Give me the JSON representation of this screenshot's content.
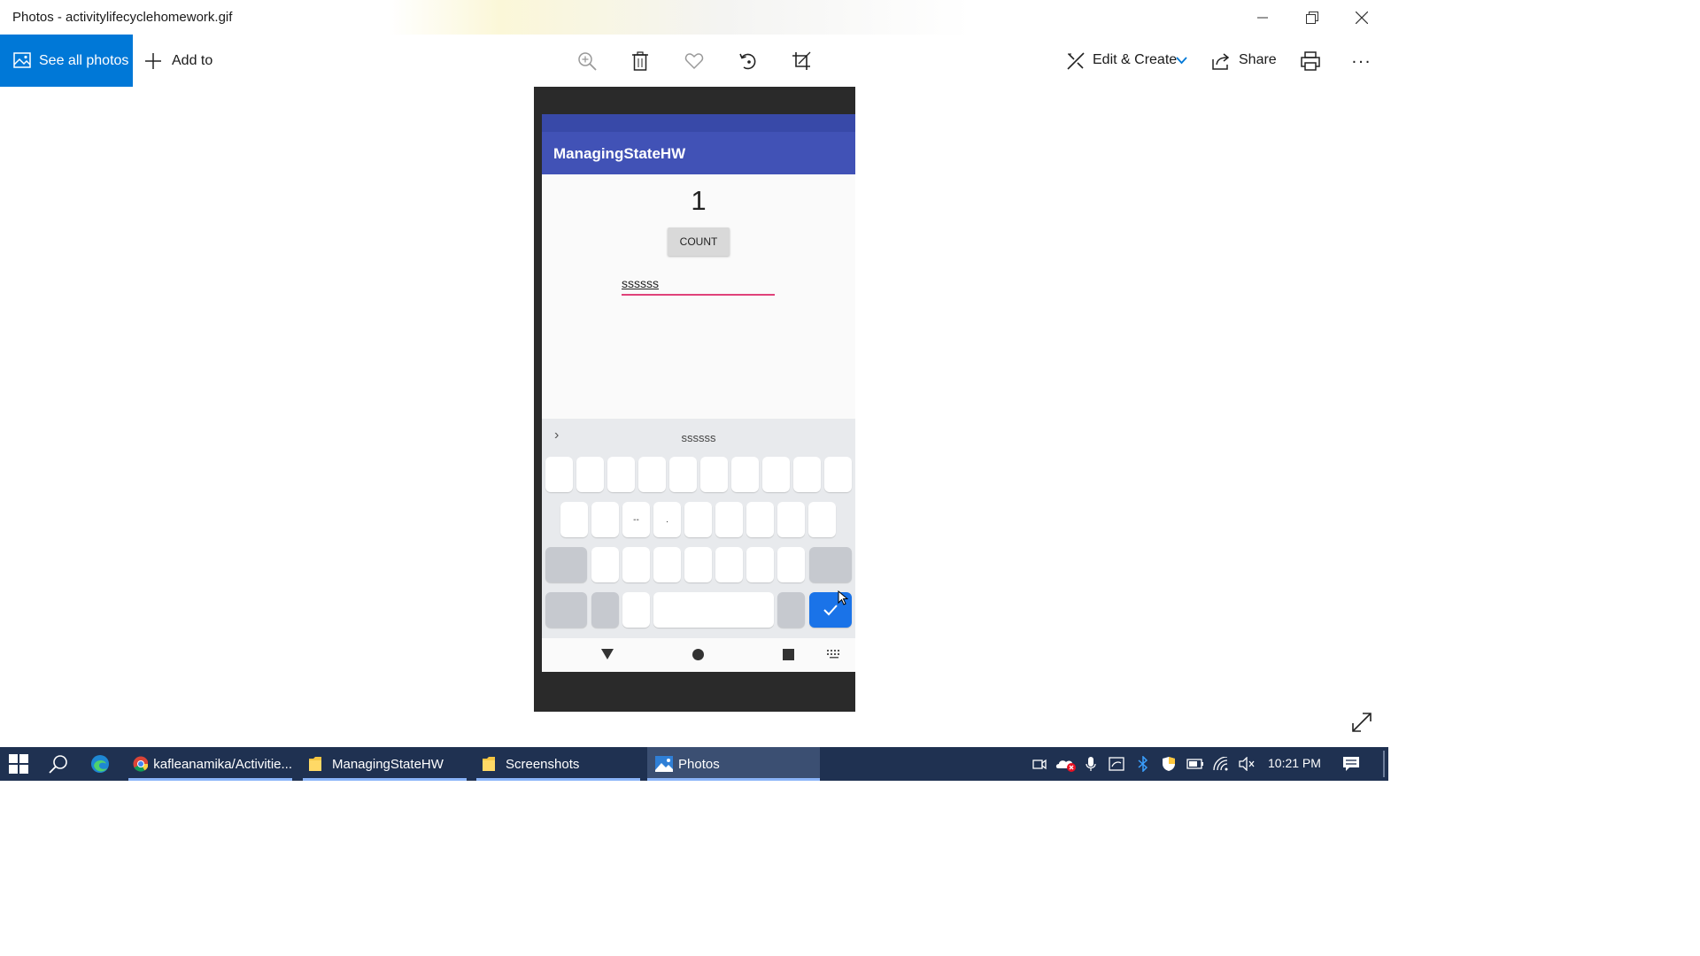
{
  "window": {
    "title": "Photos - activitylifecyclehomework.gif",
    "controls": [
      "minimize",
      "restore",
      "close"
    ]
  },
  "toolbar": {
    "see_all_photos": "See all photos",
    "add_to": "Add to",
    "icons": [
      "zoom-icon",
      "delete-icon",
      "heart-icon",
      "rotate-icon",
      "crop-icon"
    ],
    "edit_create": "Edit & Create",
    "share": "Share",
    "more": "..."
  },
  "phone": {
    "app_title": "ManagingStateHW",
    "counter_value": "1",
    "count_button": "COUNT",
    "edit_text_value": "ssssss",
    "keyboard_suggestion": "ssssss",
    "key_labels": {
      "row2_key3": "--",
      "row2_key4": "."
    }
  },
  "taskbar": {
    "items": [
      {
        "label": "kafleanamika/Activitie...",
        "icon": "chrome-icon"
      },
      {
        "label": "ManagingStateHW",
        "icon": "folder-icon"
      },
      {
        "label": "Screenshots",
        "icon": "folder-icon"
      },
      {
        "label": "Photos",
        "icon": "photos-icon",
        "active": true
      }
    ],
    "clock": "10:21 PM"
  },
  "colors": {
    "accent": "#0078d7",
    "app_bar": "#4152b6",
    "taskbar": "#1f3151",
    "edit_underline": "#e0427a",
    "keyboard_action": "#1a73e8"
  }
}
